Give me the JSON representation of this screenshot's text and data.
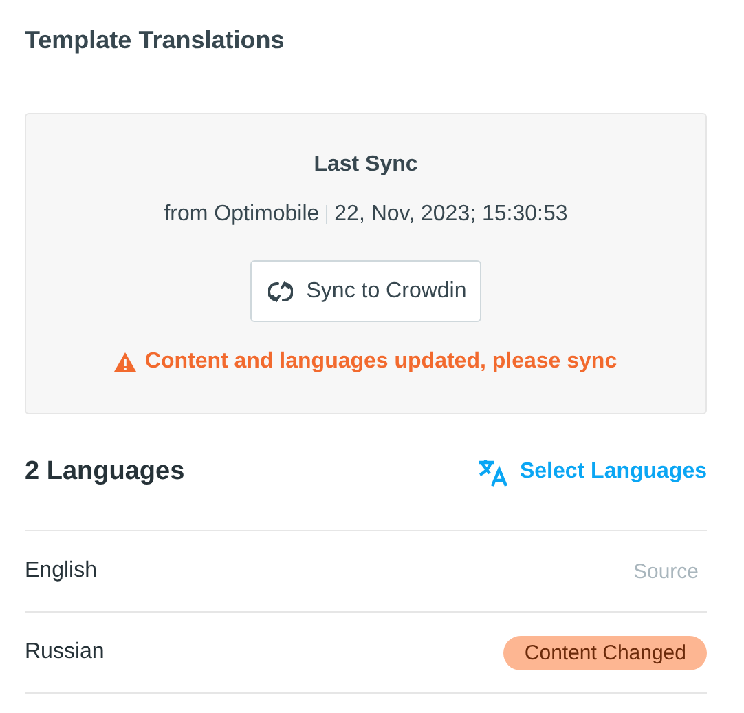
{
  "title": "Template Translations",
  "sync": {
    "heading": "Last Sync",
    "source": "from Optimobile",
    "timestamp": "22, Nov, 2023; 15:30:53",
    "button": "Sync to Crowdin",
    "warning": "Content and languages updated, please sync"
  },
  "languages": {
    "count_label": "2 Languages",
    "select_link": "Select Languages",
    "rows": [
      {
        "name": "English",
        "status": "Source",
        "kind": "note"
      },
      {
        "name": "Russian",
        "status": "Content Changed",
        "kind": "badge"
      }
    ]
  }
}
